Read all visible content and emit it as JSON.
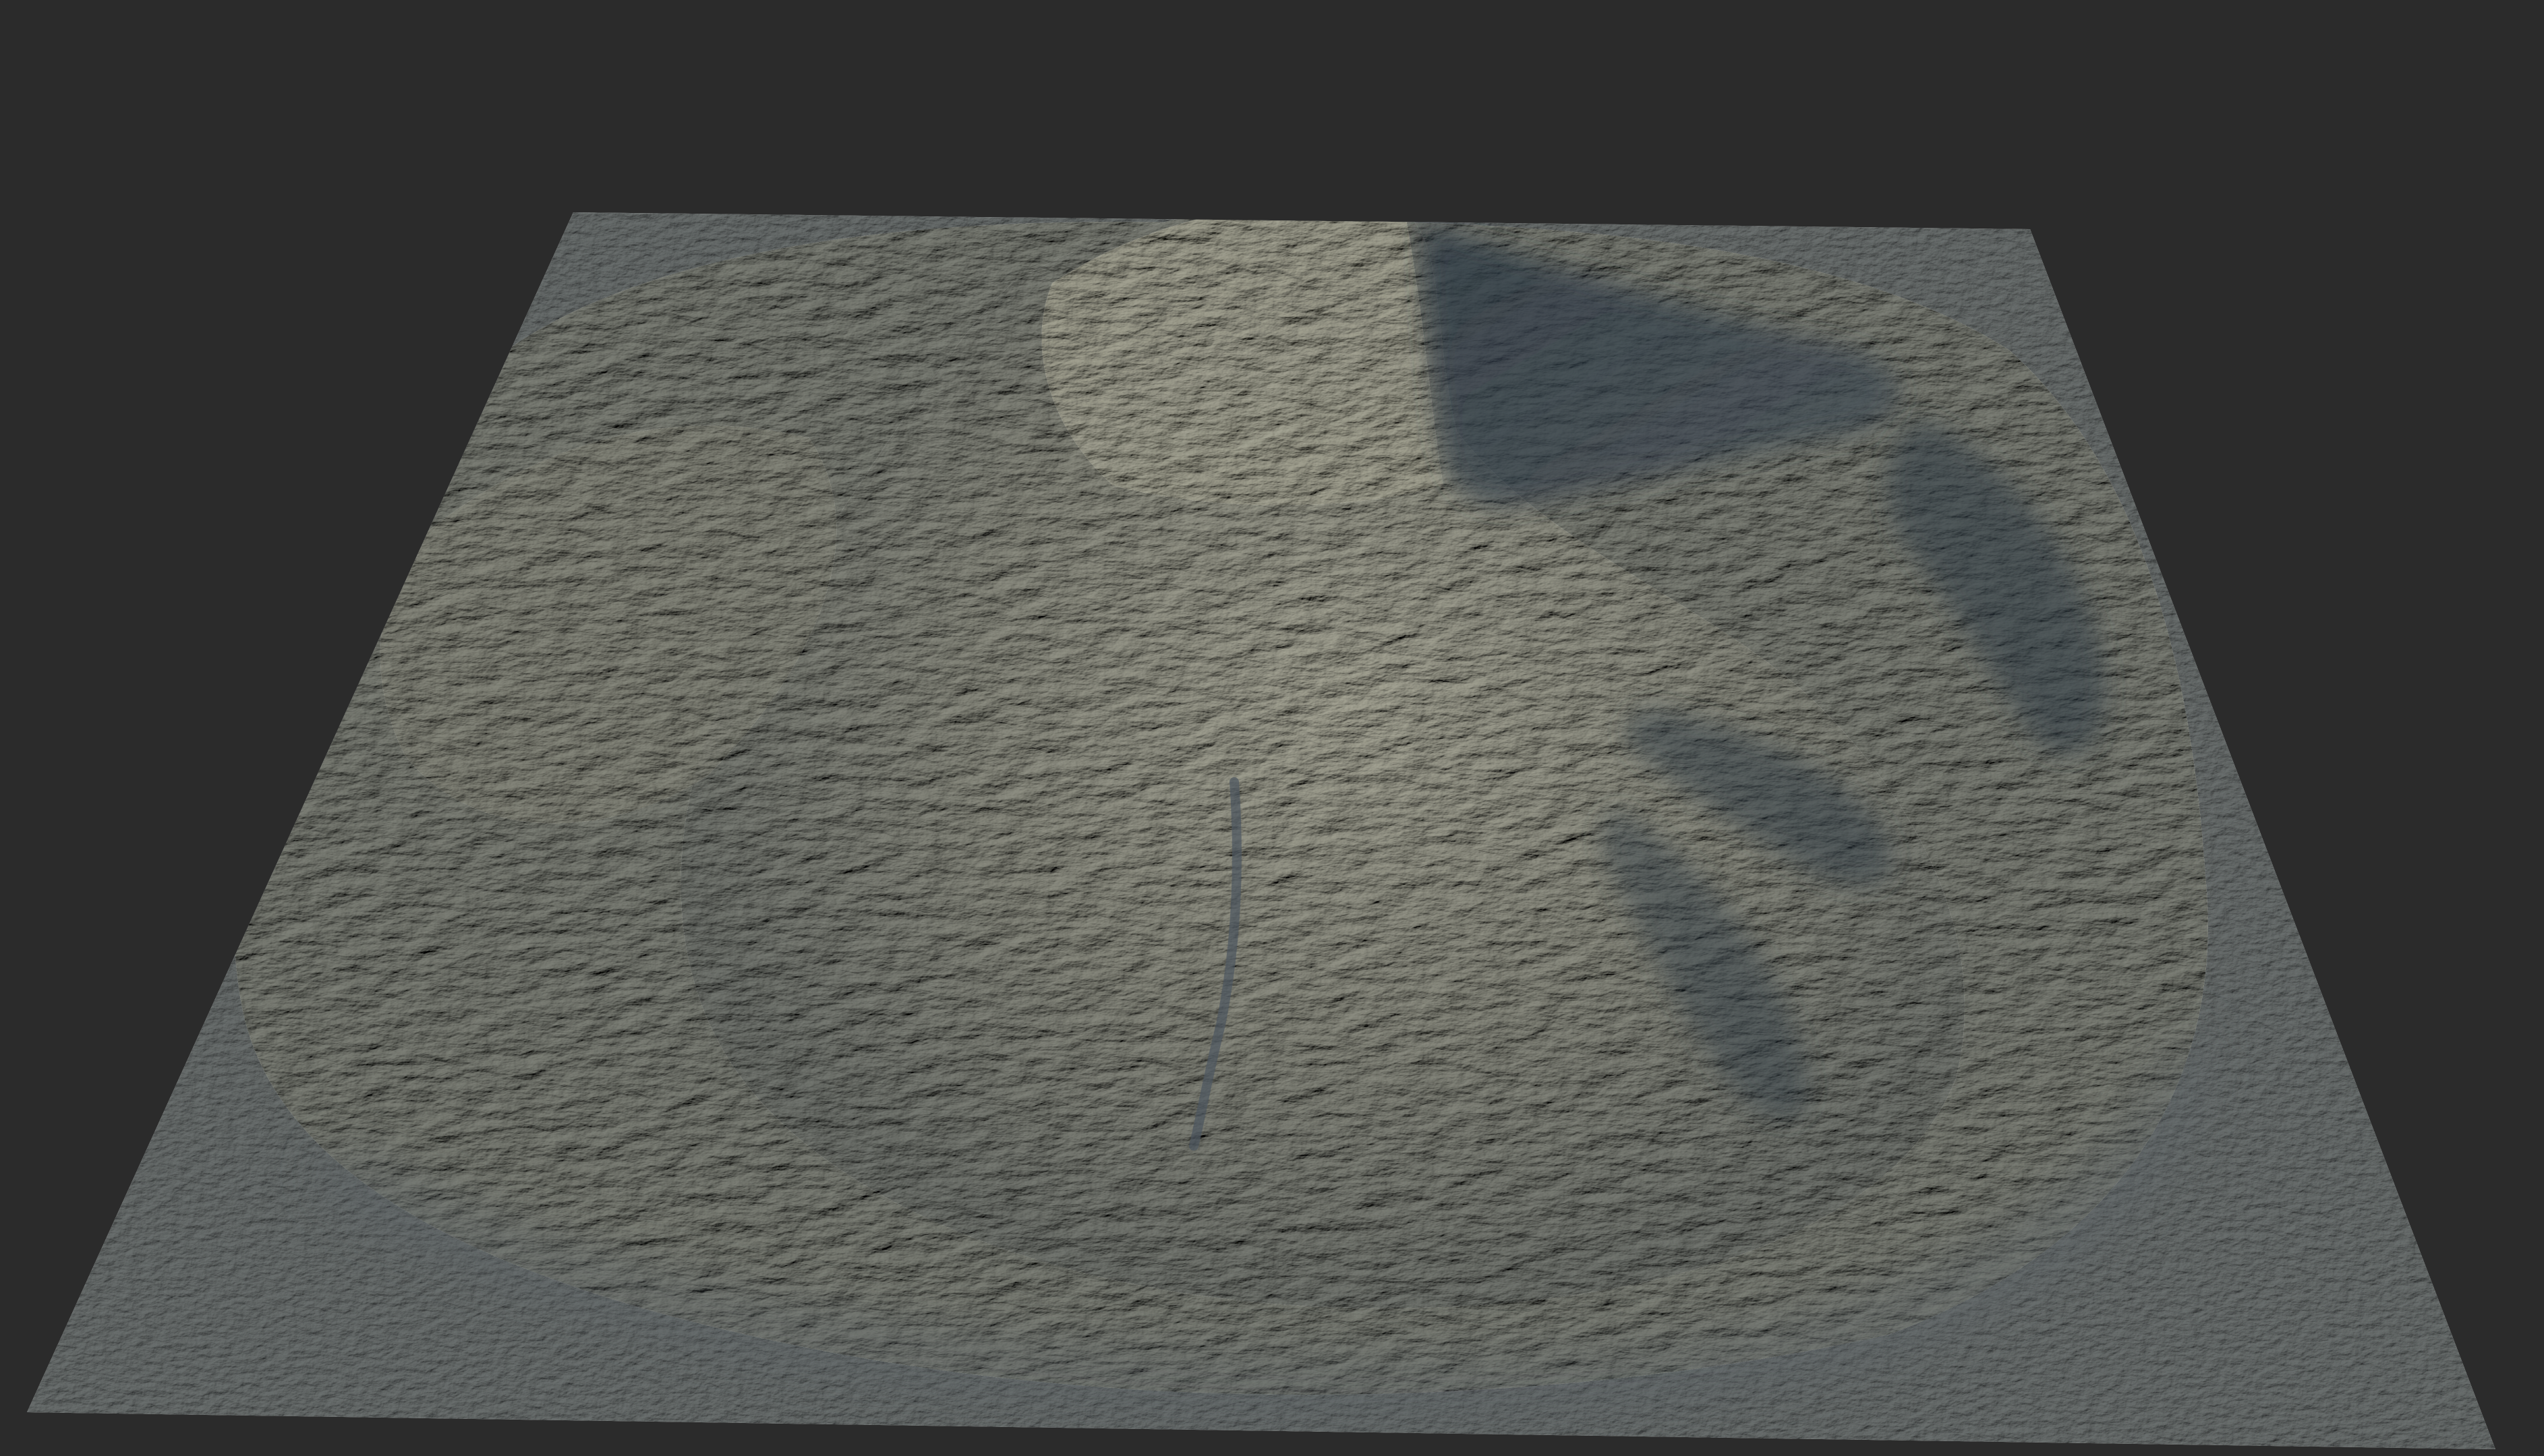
{
  "scene": {
    "background_color": "#2b2b2b",
    "plane_color": "#7f858a",
    "rock_light_color": "#b9bab0",
    "rock_mid_color": "#8e9291",
    "shadow_color": "#2f3a45"
  }
}
